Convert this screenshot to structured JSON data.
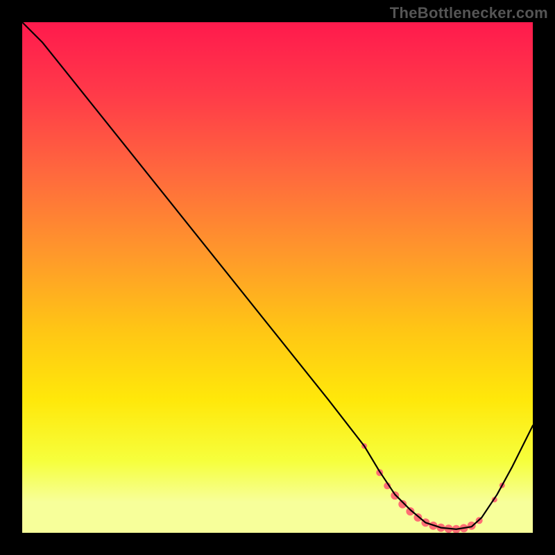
{
  "watermark": "TheBottleneсker.com",
  "chart_data": {
    "type": "line",
    "title": "",
    "xlabel": "",
    "ylabel": "",
    "xlim": [
      0,
      100
    ],
    "ylim": [
      0,
      100
    ],
    "grid": false,
    "legend": false,
    "series": [
      {
        "name": "bottleneck-curve",
        "x": [
          0,
          4,
          10,
          20,
          30,
          40,
          50,
          60,
          67,
          70,
          73,
          76,
          79,
          82,
          85,
          88,
          90,
          93,
          96,
          100
        ],
        "y": [
          100,
          96,
          88.5,
          76,
          63.5,
          51,
          38.5,
          26,
          17,
          12,
          7.5,
          4.5,
          2,
          1,
          0.7,
          1.2,
          3,
          7.5,
          13,
          21
        ]
      }
    ],
    "markers": {
      "name": "highlighted-points",
      "points": [
        {
          "x": 67.0,
          "y": 17.0,
          "r": 4
        },
        {
          "x": 70.0,
          "y": 11.8,
          "r": 5
        },
        {
          "x": 71.5,
          "y": 9.2,
          "r": 5
        },
        {
          "x": 73.0,
          "y": 7.3,
          "r": 6
        },
        {
          "x": 74.5,
          "y": 5.6,
          "r": 6
        },
        {
          "x": 76.0,
          "y": 4.2,
          "r": 6
        },
        {
          "x": 77.5,
          "y": 3.0,
          "r": 6
        },
        {
          "x": 79.0,
          "y": 2.0,
          "r": 6
        },
        {
          "x": 80.5,
          "y": 1.4,
          "r": 6
        },
        {
          "x": 82.0,
          "y": 1.0,
          "r": 6
        },
        {
          "x": 83.5,
          "y": 0.8,
          "r": 6
        },
        {
          "x": 85.0,
          "y": 0.7,
          "r": 6
        },
        {
          "x": 86.5,
          "y": 0.9,
          "r": 6
        },
        {
          "x": 88.0,
          "y": 1.4,
          "r": 6
        },
        {
          "x": 89.5,
          "y": 2.4,
          "r": 5
        },
        {
          "x": 92.5,
          "y": 6.5,
          "r": 4
        },
        {
          "x": 94.0,
          "y": 9.3,
          "r": 4
        }
      ]
    },
    "background": {
      "gradient_stops": [
        {
          "offset": 0.0,
          "color": "#ff1a4d"
        },
        {
          "offset": 0.14,
          "color": "#ff3a49"
        },
        {
          "offset": 0.3,
          "color": "#ff6a3d"
        },
        {
          "offset": 0.46,
          "color": "#ff9a2a"
        },
        {
          "offset": 0.6,
          "color": "#ffc515"
        },
        {
          "offset": 0.74,
          "color": "#ffe80a"
        },
        {
          "offset": 0.86,
          "color": "#f6ff3d"
        },
        {
          "offset": 0.94,
          "color": "#f7ff9a"
        },
        {
          "offset": 1.0,
          "color": "#f7ff9a"
        }
      ]
    }
  }
}
